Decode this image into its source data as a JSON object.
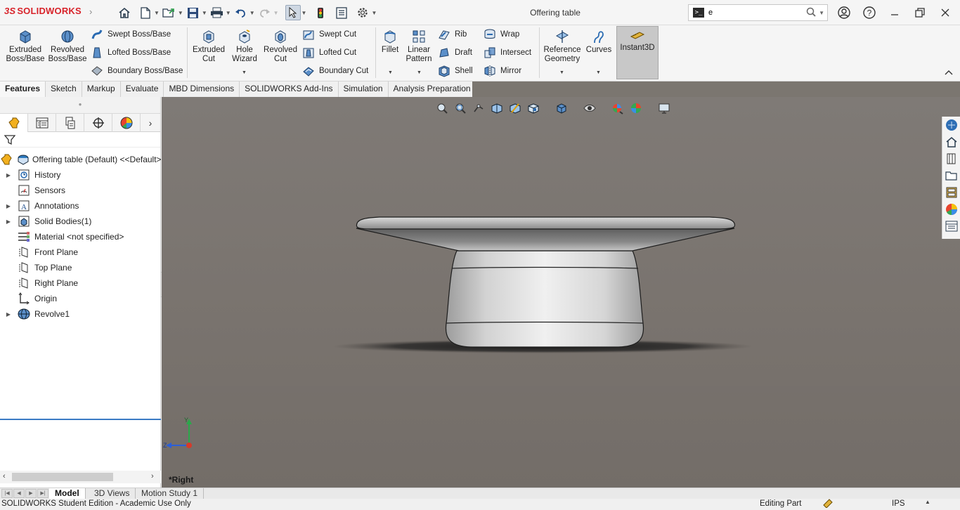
{
  "app": {
    "logo_ds": "3S",
    "logo_text": "SOLIDWORKS",
    "document_title": "Offering table"
  },
  "search": {
    "value": "e"
  },
  "ribbon": {
    "extruded_boss": "Extruded Boss/Base",
    "revolved_boss": "Revolved Boss/Base",
    "swept_boss": "Swept Boss/Base",
    "lofted_boss": "Lofted Boss/Base",
    "boundary_boss": "Boundary Boss/Base",
    "extruded_cut": "Extruded Cut",
    "hole_wizard": "Hole Wizard",
    "revolved_cut": "Revolved Cut",
    "swept_cut": "Swept Cut",
    "lofted_cut": "Lofted Cut",
    "boundary_cut": "Boundary Cut",
    "fillet": "Fillet",
    "linear_pattern": "Linear Pattern",
    "rib": "Rib",
    "draft": "Draft",
    "shell": "Shell",
    "wrap": "Wrap",
    "intersect": "Intersect",
    "mirror": "Mirror",
    "reference_geometry": "Reference Geometry",
    "curves": "Curves",
    "instant3d": "Instant3D"
  },
  "command_tabs": [
    "Features",
    "Sketch",
    "Markup",
    "Evaluate",
    "MBD Dimensions",
    "SOLIDWORKS Add-Ins",
    "Simulation",
    "Analysis Preparation"
  ],
  "tree": {
    "root": "Offering table (Default) <<Default>",
    "items": [
      {
        "label": "History",
        "expandable": true
      },
      {
        "label": "Sensors",
        "expandable": false
      },
      {
        "label": "Annotations",
        "expandable": true
      },
      {
        "label": "Solid Bodies(1)",
        "expandable": true
      },
      {
        "label": "Material <not specified>",
        "expandable": false
      },
      {
        "label": "Front Plane",
        "expandable": false
      },
      {
        "label": "Top Plane",
        "expandable": false
      },
      {
        "label": "Right Plane",
        "expandable": false
      },
      {
        "label": "Origin",
        "expandable": false
      },
      {
        "label": "Revolve1",
        "expandable": true
      }
    ]
  },
  "viewport": {
    "view_name": "*Right",
    "triad_y": "Y",
    "triad_z": "Z"
  },
  "bottom_tabs": [
    "Model",
    "3D Views",
    "Motion Study 1"
  ],
  "status": {
    "left": "SOLIDWORKS Student Edition - Academic Use Only",
    "mode": "Editing Part",
    "units": "IPS"
  },
  "colors": {
    "brand_red": "#d8232a",
    "viewport_bg": "#7a746f",
    "selection_blue": "#3b7bc4"
  }
}
